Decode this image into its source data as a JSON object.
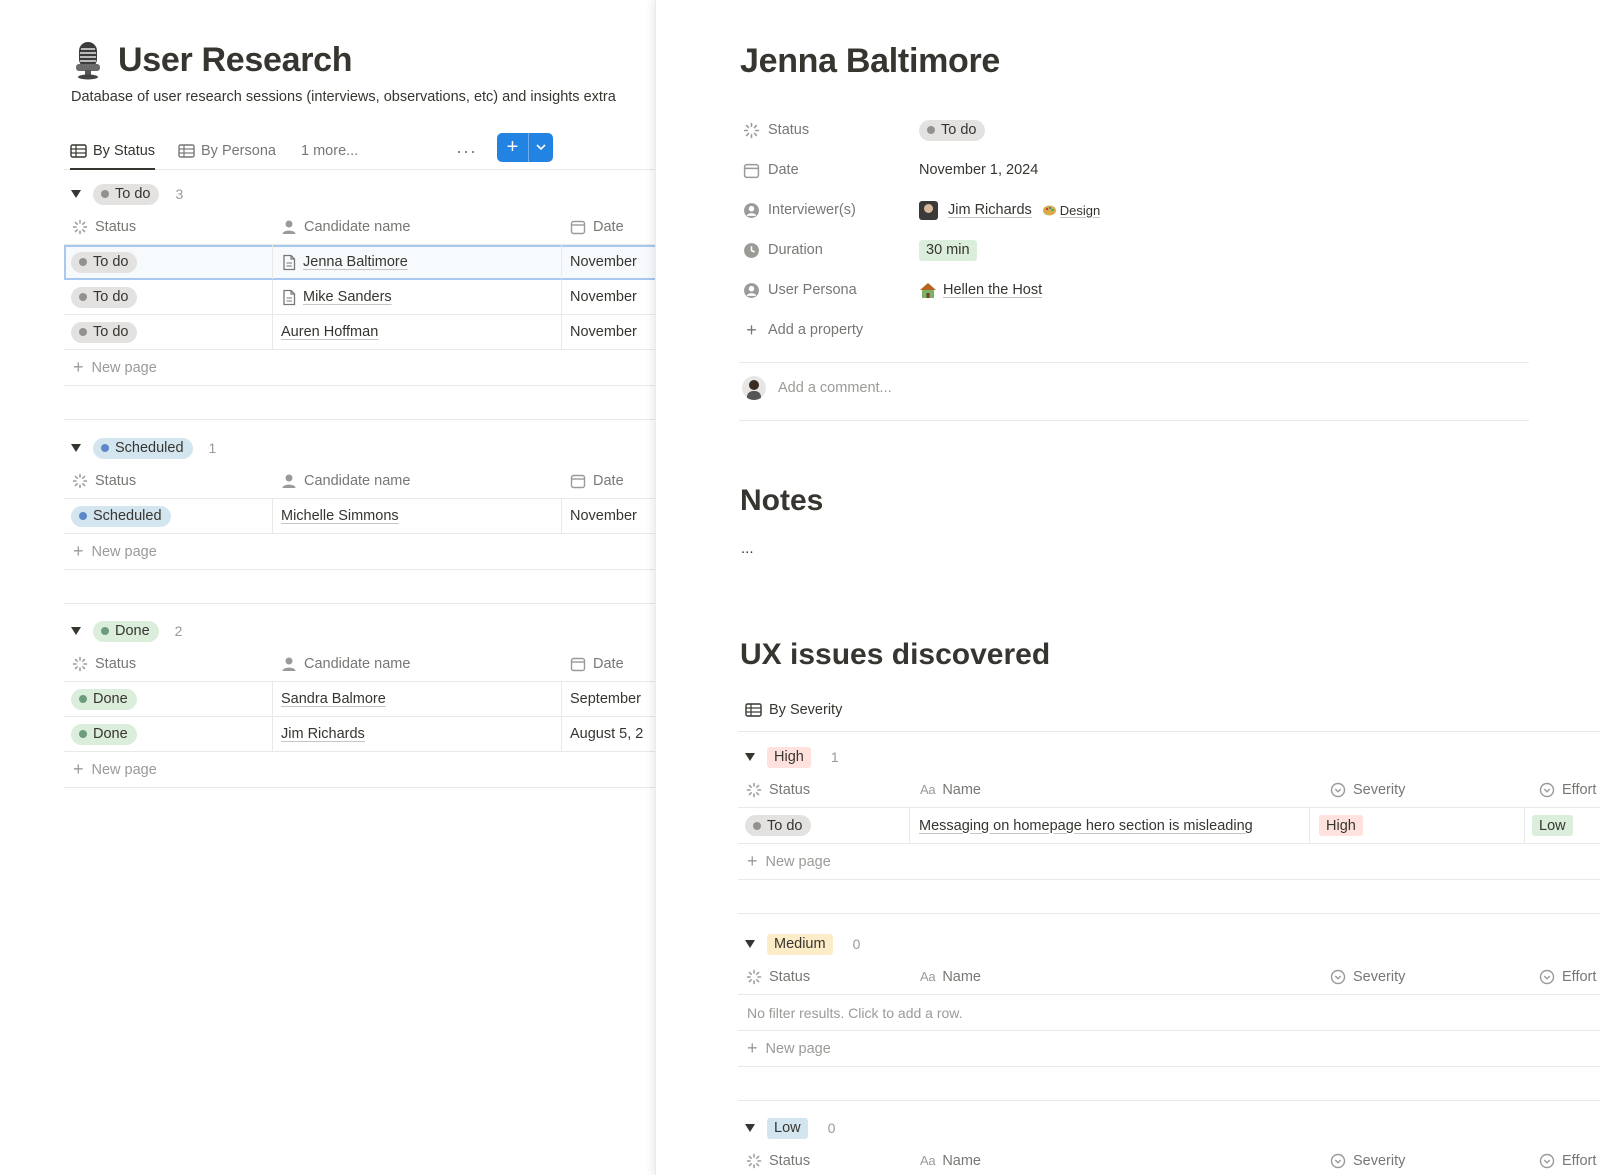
{
  "database": {
    "title": "User Research",
    "description": "Database of user research sessions (interviews, observations, etc) and insights extra",
    "views": [
      {
        "label": "By Status"
      },
      {
        "label": "By Persona"
      }
    ],
    "more_views": "1 more...",
    "more_menu": "···",
    "new_button": "+",
    "columns": {
      "status": "Status",
      "candidate": "Candidate name",
      "date": "Date"
    },
    "new_page_label": "New page",
    "groups": [
      {
        "label": "To do",
        "color": "gray",
        "count": "3",
        "rows": [
          {
            "status": "To do",
            "name": "Jenna Baltimore",
            "date": "November",
            "has_page_icon": true
          },
          {
            "status": "To do",
            "name": "Mike Sanders",
            "date": "November",
            "has_page_icon": true
          },
          {
            "status": "To do",
            "name": "Auren Hoffman",
            "date": "November",
            "has_page_icon": false
          }
        ]
      },
      {
        "label": "Scheduled",
        "color": "blue",
        "count": "1",
        "rows": [
          {
            "status": "Scheduled",
            "name": "Michelle Simmons",
            "date": "November",
            "has_page_icon": false
          }
        ]
      },
      {
        "label": "Done",
        "color": "green",
        "count": "2",
        "rows": [
          {
            "status": "Done",
            "name": "Sandra Balmore",
            "date": "September",
            "has_page_icon": false
          },
          {
            "status": "Done",
            "name": "Jim Richards",
            "date": "August 5, 2",
            "has_page_icon": false
          }
        ]
      }
    ]
  },
  "peek": {
    "title": "Jenna Baltimore",
    "properties": {
      "status": {
        "label": "Status",
        "value": "To do"
      },
      "date": {
        "label": "Date",
        "value": "November 1, 2024"
      },
      "interviewers": {
        "label": "Interviewer(s)",
        "value": "Jim Richards",
        "team": "Design"
      },
      "duration": {
        "label": "Duration",
        "value": "30 min"
      },
      "persona": {
        "label": "User Persona",
        "value": "Hellen the Host"
      }
    },
    "add_property": "Add a property",
    "comment_placeholder": "Add a comment...",
    "notes_heading": "Notes",
    "notes_body": "...",
    "ux_heading": "UX issues discovered",
    "ux_view": "By Severity",
    "ux_columns": {
      "status": "Status",
      "name": "Name",
      "severity": "Severity",
      "effort": "Effort",
      "name_prefix": "Aa"
    },
    "ux_groups": [
      {
        "label": "High",
        "count": "1",
        "rows": [
          {
            "status": "To do",
            "name": "Messaging on homepage hero section is misleading",
            "severity": "High",
            "effort": "Low"
          }
        ]
      },
      {
        "label": "Medium",
        "count": "0",
        "empty_text": "No filter results. Click to add a row."
      },
      {
        "label": "Low",
        "count": "0"
      }
    ],
    "new_page_label": "New page"
  },
  "colors": {
    "accent": "#2383e2",
    "gray_tag": "#e3e2e0",
    "blue_tag": "#d3e5ef",
    "green_tag": "#dbeddb",
    "red_tag": "#ffe2dd",
    "yellow_tag": "#fdecc8"
  }
}
